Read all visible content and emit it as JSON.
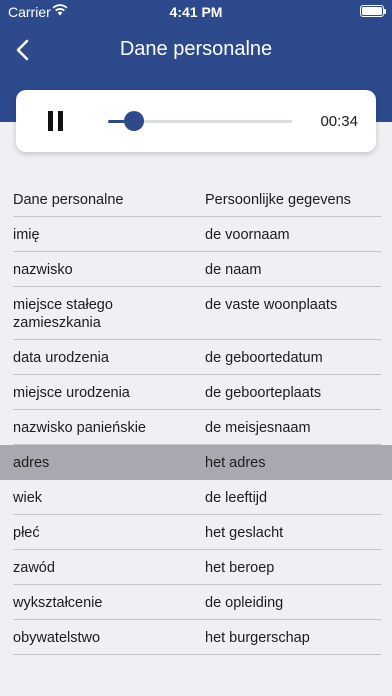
{
  "status": {
    "carrier": "Carrier",
    "time": "4:41 PM"
  },
  "header": {
    "title": "Dane personalne"
  },
  "player": {
    "elapsed": "00:34",
    "progress": 0.14
  },
  "table": {
    "columns": [
      "Dane personalne",
      "Persoonlijke gegevens"
    ],
    "rows": [
      {
        "pl": "imię",
        "nl": "de voornaam"
      },
      {
        "pl": "nazwisko",
        "nl": "de naam"
      },
      {
        "pl": "miejsce stałego zamieszkania",
        "nl": "de vaste woonplaats"
      },
      {
        "pl": "data urodzenia",
        "nl": "de geboortedatum"
      },
      {
        "pl": "miejsce urodzenia",
        "nl": "de geboorteplaats"
      },
      {
        "pl": "nazwisko panieńskie",
        "nl": "de meisjesnaam"
      },
      {
        "pl": "adres",
        "nl": "het adres",
        "active": true
      },
      {
        "pl": "wiek",
        "nl": "de leeftijd"
      },
      {
        "pl": "płeć",
        "nl": "het geslacht"
      },
      {
        "pl": "zawód",
        "nl": "het beroep"
      },
      {
        "pl": "wykształcenie",
        "nl": "de opleiding"
      },
      {
        "pl": "obywatelstwo",
        "nl": "het burgerschap"
      }
    ]
  },
  "colors": {
    "primary": "#2d4a8c",
    "background": "#efeff4",
    "active_row": "#a8a9b0"
  }
}
